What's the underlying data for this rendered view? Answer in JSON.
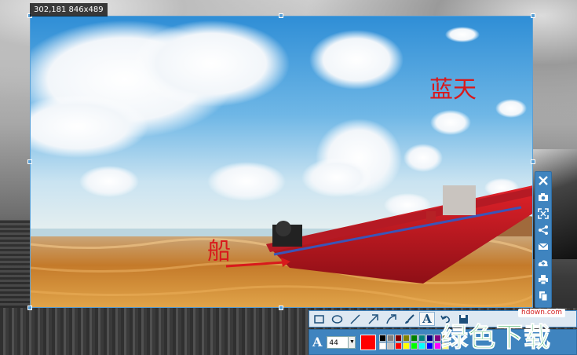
{
  "selection": {
    "info": "302,181 846x489"
  },
  "annotations": {
    "sky_label": "蓝天",
    "boat_label": "船",
    "text_color": "#d8191c"
  },
  "right_toolbar": {
    "buttons": [
      "close-icon",
      "camera-icon",
      "fullscreen-icon",
      "share-icon",
      "mail-icon",
      "cloud-upload-icon",
      "print-icon",
      "copy-icon"
    ]
  },
  "draw_toolbar": {
    "tools": [
      "rectangle-icon",
      "ellipse-icon",
      "line-icon",
      "arrow-icon",
      "curved-arrow-icon",
      "brush-icon",
      "text-icon",
      "undo-icon",
      "save-icon"
    ],
    "text_tool_glyph": "A",
    "active_tool": "text-icon"
  },
  "format_toolbar": {
    "font_glyph": "A",
    "font_size": "44",
    "current_color": "#ff0000",
    "palette": [
      "#000000",
      "#7f7f7f",
      "#800000",
      "#808000",
      "#008000",
      "#008080",
      "#000080",
      "#800080",
      "#808040",
      "#ffffff",
      "#c0c0c0",
      "#ff0000",
      "#ffff00",
      "#00ff00",
      "#00ffff",
      "#0000ff",
      "#ff00ff",
      "#ffff80"
    ]
  },
  "watermark": {
    "url": "hdown.com",
    "text": "绿色下载"
  }
}
